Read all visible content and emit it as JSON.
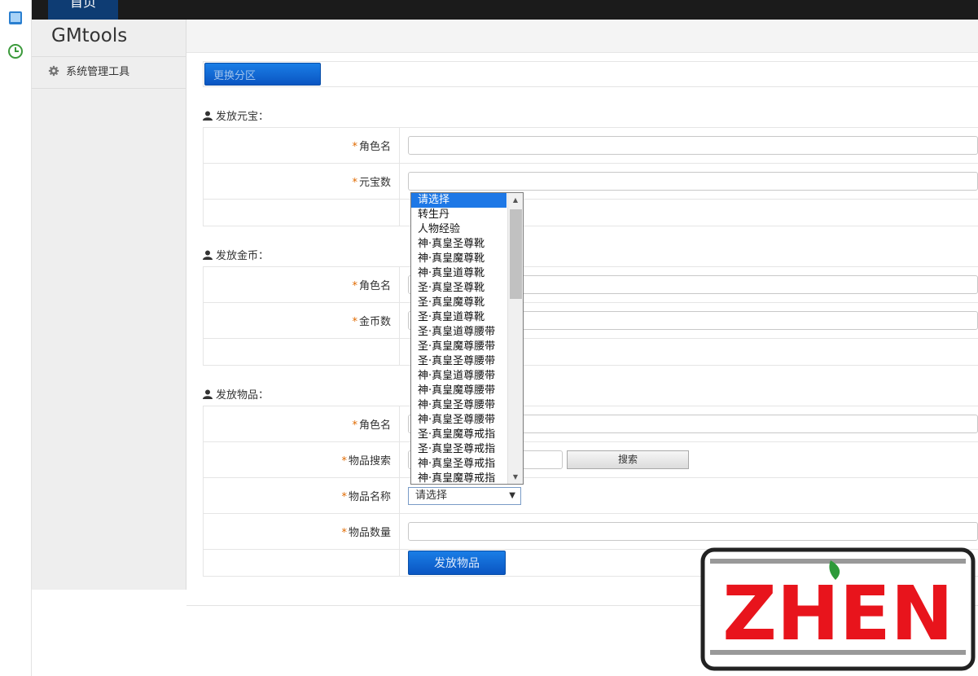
{
  "topbar": {
    "home_tab": "首页"
  },
  "sidebar": {
    "brand": "GMtools",
    "items": [
      {
        "label": "系统管理工具",
        "icon": "gear-icon"
      }
    ]
  },
  "actions": {
    "switch_partition": "更换分区"
  },
  "sections": [
    {
      "title": "发放元宝：",
      "fields": [
        {
          "label": "角色名",
          "required": true,
          "value": ""
        },
        {
          "label": "元宝数",
          "required": true,
          "value": ""
        }
      ]
    },
    {
      "title": "发放金币：",
      "fields": [
        {
          "label": "角色名",
          "required": true,
          "value": ""
        },
        {
          "label": "金币数",
          "required": true,
          "value": ""
        }
      ]
    },
    {
      "title": "发放物品：",
      "fields": [
        {
          "label": "角色名",
          "required": true,
          "value": ""
        },
        {
          "label": "物品搜索",
          "required": true,
          "value": "",
          "button": "搜索"
        },
        {
          "label": "物品名称",
          "required": true,
          "selected": "请选择"
        },
        {
          "label": "物品数量",
          "required": true,
          "value": ""
        }
      ],
      "submit": "发放物品"
    }
  ],
  "dropdown": {
    "options": [
      "请选择",
      "转生丹",
      "人物经验",
      "神·真皇圣尊靴",
      "神·真皇魔尊靴",
      "神·真皇道尊靴",
      "圣·真皇圣尊靴",
      "圣·真皇魔尊靴",
      "圣·真皇道尊靴",
      "圣·真皇道尊腰带",
      "圣·真皇魔尊腰带",
      "圣·真皇圣尊腰带",
      "神·真皇道尊腰带",
      "神·真皇魔尊腰带",
      "神·真皇圣尊腰带",
      "神·真皇圣尊腰带",
      "圣·真皇魔尊戒指",
      "圣·真皇圣尊戒指",
      "神·真皇圣尊戒指",
      "神·真皇魔尊戒指"
    ],
    "selected_index": 0
  },
  "watermark": {
    "text": "ZHEN"
  },
  "colors": {
    "accent": "#0a55c2",
    "required": "#e06a00",
    "topbar": "#1b1b1b",
    "logo_red": "#e8141c"
  }
}
